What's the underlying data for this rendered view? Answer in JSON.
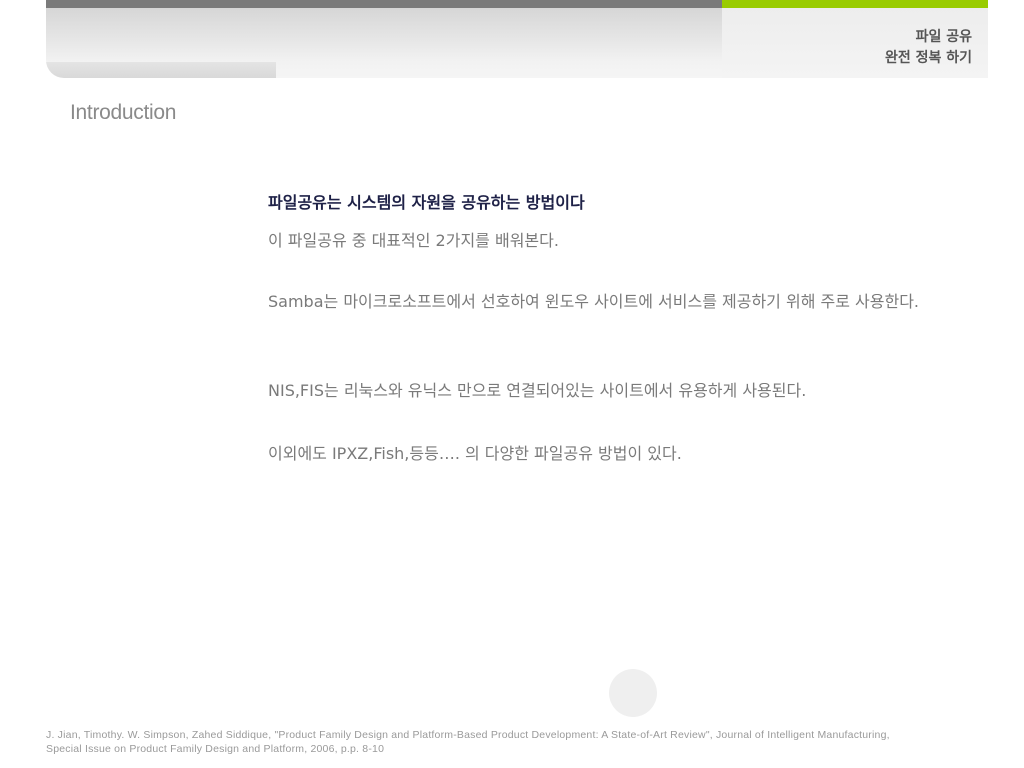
{
  "header": {
    "title_line1": "파일 공유",
    "title_line2": "완전 정복 하기",
    "bar_color": "#7a7a7a",
    "accent_color": "#99cc00"
  },
  "slide": {
    "section_title": "Introduction",
    "heading": "파일공유는 시스템의 자원을 공유하는 방법이다",
    "paragraphs": [
      "이 파일공유 중 대표적인 2가지를 배워본다.",
      "Samba는 마이크로소프트에서 선호하여 윈도우 사이트에 서비스를 제공하기 위해 주로 사용한다.",
      "NIS,FIS는 리눅스와 유닉스 만으로 연결되어있는 사이트에서 유용하게 사용된다.",
      "이외에도 IPXZ,Fish,등등…. 의 다양한 파일공유 방법이 있다."
    ]
  },
  "footer": {
    "citation": "J. Jian, Timothy. W. Simpson, Zahed Siddique, \"Product Family Design and Platform-Based Product Development: A State-of-Art Review\", Journal of Intelligent Manufacturing, Special Issue on Product Family Design and Platform, 2006, p.p. 8-10"
  }
}
